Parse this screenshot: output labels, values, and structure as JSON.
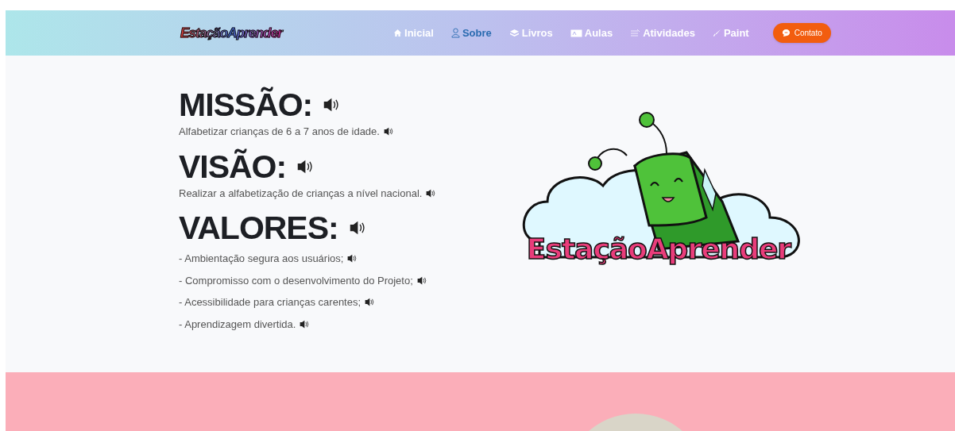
{
  "header": {
    "logo": "EstaçãoAprender",
    "nav": [
      {
        "label": "Inicial",
        "selected": false
      },
      {
        "label": "Sobre",
        "selected": true
      },
      {
        "label": "Livros",
        "selected": false
      },
      {
        "label": "Aulas",
        "selected": false
      },
      {
        "label": "Atividades",
        "selected": false
      },
      {
        "label": "Paint",
        "selected": false
      }
    ],
    "contact_button": "Contato"
  },
  "sections": [
    {
      "heading": "MISSÃO:",
      "lines": [
        "Alfabetizar crianças de 6 a 7 anos de idade."
      ]
    },
    {
      "heading": "VISÃO:",
      "lines": [
        "Realizar a alfabetização de crianças a nível nacional."
      ]
    },
    {
      "heading": "VALORES:",
      "lines": [
        "- Ambientação segura aos usuários;",
        "- Compromisso com o desenvolvimento do Projeto;",
        "- Acessibilidade para crianças carentes;",
        "- Aprendizagem divertida."
      ]
    }
  ],
  "illustration": {
    "logo": "EstaçãoAprender"
  }
}
